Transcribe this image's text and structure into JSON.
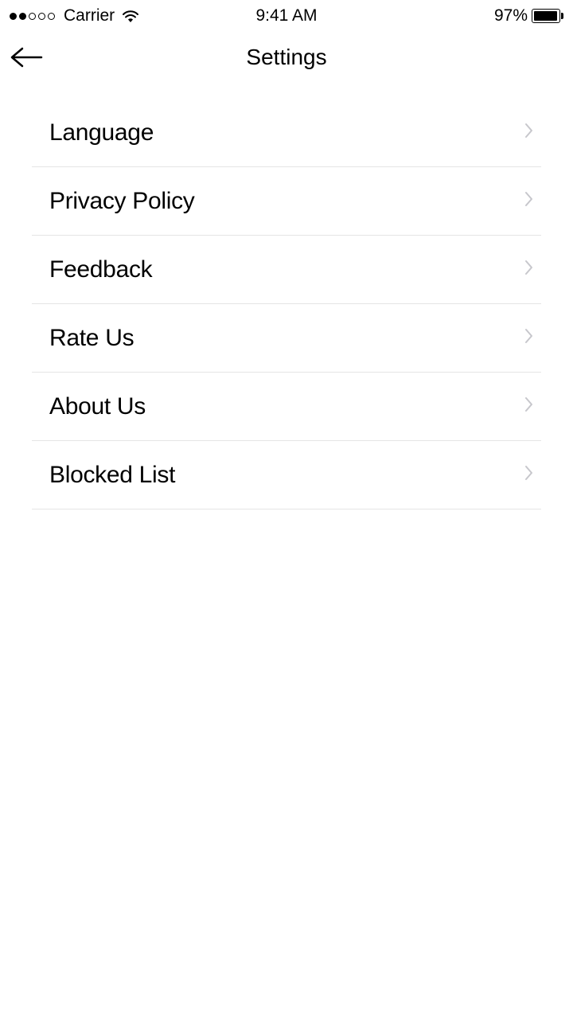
{
  "status_bar": {
    "carrier": "Carrier",
    "time": "9:41 AM",
    "battery_pct": "97%"
  },
  "header": {
    "title": "Settings"
  },
  "settings": {
    "items": [
      {
        "label": "Language"
      },
      {
        "label": "Privacy Policy"
      },
      {
        "label": "Feedback"
      },
      {
        "label": "Rate Us"
      },
      {
        "label": "About Us"
      },
      {
        "label": "Blocked List"
      }
    ]
  }
}
